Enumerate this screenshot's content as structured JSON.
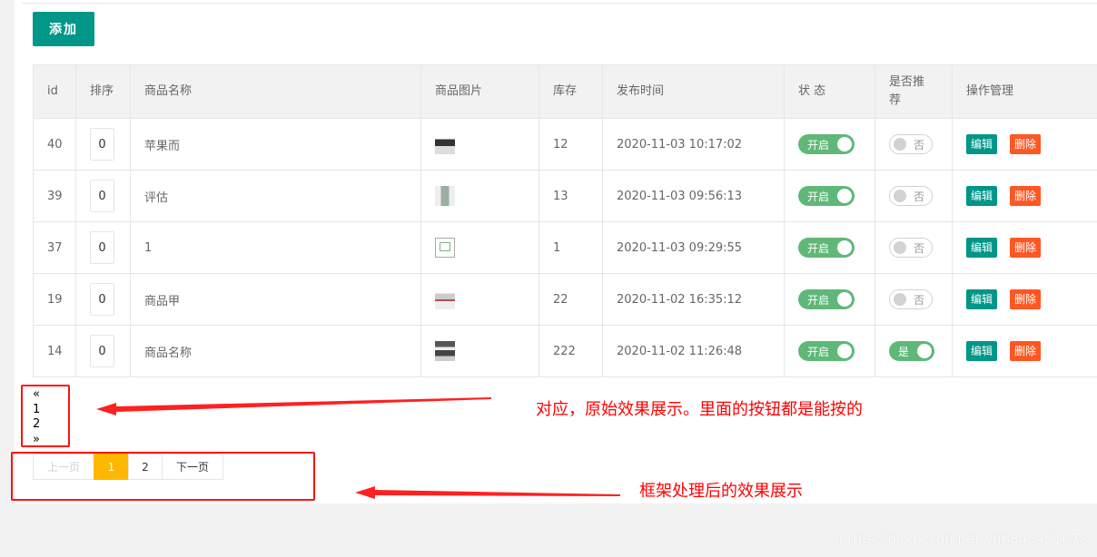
{
  "toolbar": {
    "add_label": "添加"
  },
  "table": {
    "headers": {
      "id": "id",
      "sort": "排序",
      "name": "商品名称",
      "image": "商品图片",
      "stock": "库存",
      "time": "发布时间",
      "status": "状 态",
      "recommend_line1": "是否推",
      "recommend_line2": "荐",
      "actions": "操作管理"
    },
    "rows": [
      {
        "id": "40",
        "sort": "0",
        "name": "苹果而",
        "stock": "12",
        "time": "2020-11-03 10:17:02",
        "status": "开启",
        "recommend": "否"
      },
      {
        "id": "39",
        "sort": "0",
        "name": "评估",
        "stock": "13",
        "time": "2020-11-03 09:56:13",
        "status": "开启",
        "recommend": "否"
      },
      {
        "id": "37",
        "sort": "0",
        "name": "1",
        "stock": "1",
        "time": "2020-11-03 09:29:55",
        "status": "开启",
        "recommend": "否"
      },
      {
        "id": "19",
        "sort": "0",
        "name": "商品甲",
        "stock": "22",
        "time": "2020-11-02 16:35:12",
        "status": "开启",
        "recommend": "否"
      },
      {
        "id": "14",
        "sort": "0",
        "name": "商品名称",
        "stock": "222",
        "time": "2020-11-02 11:26:48",
        "status": "开启",
        "recommend": "是"
      }
    ],
    "edit_label": "编辑",
    "delete_label": "删除"
  },
  "raw_pager": {
    "prev": "«",
    "page1": "1",
    "page2": "2",
    "next": "»"
  },
  "pager": {
    "prev": "上一页",
    "page1": "1",
    "page2": "2",
    "next": "下一页"
  },
  "annotations": {
    "raw": "对应，原始效果展示。里面的按钮都是能按的",
    "framework": "框架处理后的效果展示"
  },
  "watermark": "https://blog.csdn.net/yqh845451078",
  "colors": {
    "primary": "#009688",
    "switch_on": "#5fb878",
    "danger": "#ff5722",
    "pager_current": "#ffb800",
    "annotation": "#ff0000"
  }
}
